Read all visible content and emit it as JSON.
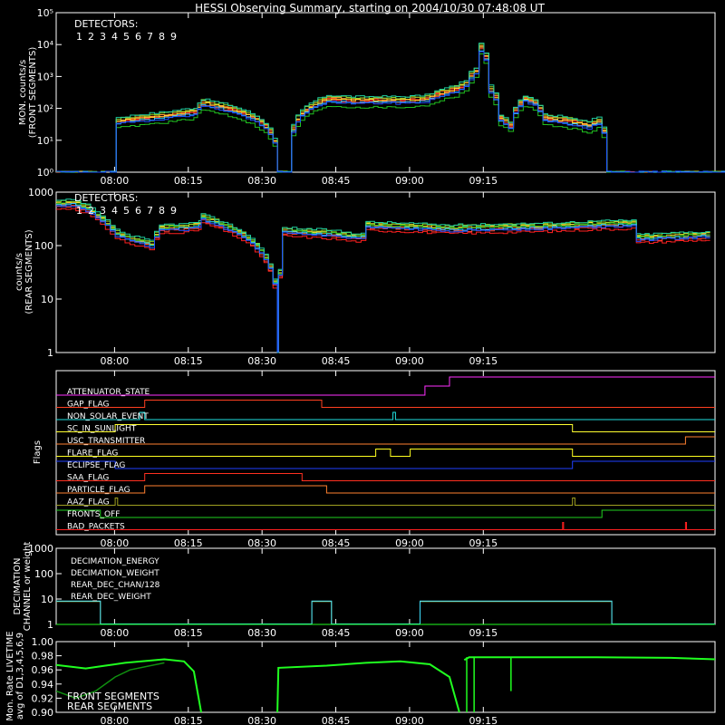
{
  "title": "HESSI Observing Summary, starting on 2004/10/30 07:48:08 UT",
  "time_axis": {
    "start": "07:48:08",
    "ticks": [
      "08:00",
      "08:15",
      "08:30",
      "08:45",
      "09:00",
      "09:15"
    ]
  },
  "detectors": {
    "label": "DETECTORS:",
    "items": [
      {
        "n": "1",
        "color": "#ff2020"
      },
      {
        "n": "2",
        "color": "#ff4030"
      },
      {
        "n": "3",
        "color": "#ff9030"
      },
      {
        "n": "4",
        "color": "#ffe030"
      },
      {
        "n": "5",
        "color": "#90d020"
      },
      {
        "n": "6",
        "color": "#20c020"
      },
      {
        "n": "7",
        "color": "#20d0a0"
      },
      {
        "n": "8",
        "color": "#30c0ff"
      },
      {
        "n": "9",
        "color": "#2050ff"
      }
    ]
  },
  "chart_data": [
    {
      "type": "line",
      "name": "front",
      "ylabel_line1": "MON. counts/s",
      "ylabel_line2": "(FRONT SEGMENTS)",
      "scale": "log",
      "ylim": [
        1,
        100000
      ],
      "yticks": [
        "10⁰",
        "10¹",
        "10²",
        "10³",
        "10⁴",
        "10⁵"
      ],
      "series_time_min": [
        0,
        11.9,
        12.2,
        17,
        22,
        28,
        29.5,
        45,
        47,
        55,
        60,
        70,
        73,
        75,
        78,
        81,
        83,
        85,
        86,
        88,
        90,
        92,
        95,
        97,
        99,
        104,
        108,
        110,
        112,
        140
      ],
      "series_values": [
        1,
        1,
        40,
        50,
        60,
        80,
        150,
        1,
        1,
        200,
        180,
        180,
        190,
        200,
        300,
        400,
        600,
        1500,
        8000,
        400,
        50,
        30,
        200,
        150,
        50,
        40,
        30,
        40,
        1,
        1
      ]
    },
    {
      "type": "line",
      "name": "rear",
      "ylabel_line1": "counts/s",
      "ylabel_line2": "(REAR SEGMENTS)",
      "scale": "log",
      "ylim": [
        1,
        1000
      ],
      "yticks": [
        "1",
        "10",
        "100",
        "1000"
      ],
      "series_time_min": [
        0,
        3,
        6,
        9,
        12,
        15,
        17,
        19,
        21,
        23,
        26,
        29,
        29.5,
        45,
        45.2,
        46,
        50,
        55,
        60,
        62,
        63,
        70,
        80,
        90,
        100,
        110,
        117,
        118,
        125,
        133
      ],
      "series_values": [
        600,
        620,
        500,
        300,
        170,
        130,
        120,
        105,
        210,
        220,
        220,
        250,
        330,
        1,
        30,
        190,
        180,
        170,
        150,
        150,
        240,
        230,
        210,
        220,
        230,
        250,
        260,
        140,
        150,
        160
      ]
    },
    {
      "type": "flags",
      "ylabel": "Flags",
      "flags": [
        {
          "name": "ATTENUATOR_STATE",
          "color": "#ff30ff"
        },
        {
          "name": "GAP_FLAG",
          "color": "#ff4020"
        },
        {
          "name": "NON_SOLAR_EVENT",
          "color": "#20e0e0"
        },
        {
          "name": "SC_IN_SUNLIGHT",
          "color": "#ffff30"
        },
        {
          "name": "USC_TRANSMITTER",
          "color": "#ff8030"
        },
        {
          "name": "FLARE_FLAG",
          "color": "#ffff20"
        },
        {
          "name": "ECLIPSE_FLAG",
          "color": "#2040ff"
        },
        {
          "name": "SAA_FLAG",
          "color": "#ff3020"
        },
        {
          "name": "PARTICLE_FLAG",
          "color": "#ff8030"
        },
        {
          "name": "AAZ_FLAG",
          "color": "#a0a020"
        },
        {
          "name": "FRONTS_OFF",
          "color": "#20d020"
        },
        {
          "name": "BAD_PACKETS",
          "color": "#ff2020"
        }
      ]
    },
    {
      "type": "line",
      "name": "decimation",
      "ylabel_line1": "DECIMATION",
      "ylabel_line2": "CHANNEL or weight",
      "scale": "log",
      "ylim": [
        1,
        1000
      ],
      "yticks": [
        "1",
        "10",
        "100",
        "1000"
      ],
      "legend": [
        {
          "label": "DECIMATION_ENERGY",
          "color": "#20ff20"
        },
        {
          "label": "DECIMATION_WEIGHT",
          "color": "#ff6040"
        },
        {
          "label": "REAR_DEC_CHAN/128",
          "color": "#40e0ff"
        },
        {
          "label": "REAR_DEC_WEIGHT",
          "color": "#c0c040"
        }
      ]
    },
    {
      "type": "line",
      "name": "livetime",
      "ylabel_line1": "Mon. Rate LIVETIME",
      "ylabel_line2": "avg of D1,3,4,5,6,9",
      "ylim": [
        0.9,
        1.0
      ],
      "yticks": [
        "0.90",
        "0.92",
        "0.94",
        "0.96",
        "0.98",
        "1.00"
      ],
      "legend": [
        {
          "label": "FRONT SEGMENTS",
          "color": "#20ff20"
        },
        {
          "label": "REAR SEGMENTS",
          "color": "#109010"
        }
      ]
    }
  ]
}
